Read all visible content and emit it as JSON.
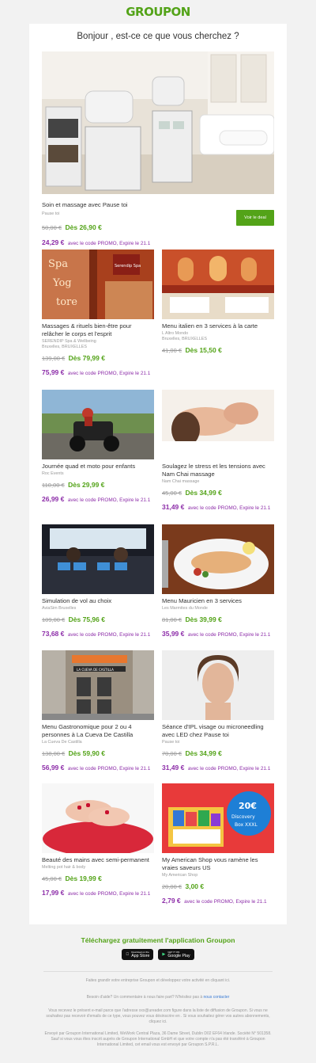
{
  "brand": {
    "logo": "GROUPON",
    "green": "#53a318",
    "purple": "#8c2ca8"
  },
  "greeting": "Bonjour , est-ce ce que vous cherchez ?",
  "hero": {
    "title": "Soin et massage avec Pause toi",
    "merchant": "Pause toi",
    "old_price": "50,00 €",
    "price": "Dès 26,90 €",
    "promo_price": "24,29 €",
    "promo_text": "avec le code PROMO, Expire le 21.1",
    "button": "Voir le deal"
  },
  "deals": [
    {
      "title": "Massages & rituels bien-être pour relâcher le corps et l'esprit",
      "merchant": "SERENDIP Spa & Wellbeing",
      "location": "Bruxelles, BRUXELLES",
      "old_price": "139,00 €",
      "price": "Dès 79,99 €",
      "promo_price": "75,99 €",
      "promo_text": "avec le code PROMO, Expire le 21.1"
    },
    {
      "title": "Menu italien en 3 services à la carte",
      "merchant": "L Altro Mondo",
      "location": "Bruxelles, BRUXELLES",
      "old_price": "41,00 €",
      "price": "Dès 15,50 €",
      "promo_price": "",
      "promo_text": ""
    },
    {
      "title": "Journée quad et moto pour enfants",
      "merchant": "Roc Events",
      "location": "",
      "old_price": "110,00 €",
      "price": "Dès 29,99 €",
      "promo_price": "26,99 €",
      "promo_text": "avec le code PROMO, Expire le 21.1"
    },
    {
      "title": "Soulagez le stress et les tensions avec Nam Chai massage",
      "merchant": "Nam Chai massage",
      "location": "",
      "old_price": "45,00 €",
      "price": "Dès 34,99 €",
      "promo_price": "31,49 €",
      "promo_text": "avec le code PROMO, Expire le 21.1"
    },
    {
      "title": "Simulation de vol au choix",
      "merchant": "AviaSim Bruxelles",
      "location": "",
      "old_price": "109,00 €",
      "price": "Dès 75,96 €",
      "promo_price": "73,68 €",
      "promo_text": "avec le code PROMO, Expire le 21.1"
    },
    {
      "title": "Menu Mauricien en 3 services",
      "merchant": "Les Marmites du Monde",
      "location": "",
      "old_price": "81,00 €",
      "price": "Dès 39,99 €",
      "promo_price": "35,99 €",
      "promo_text": "avec le code PROMO, Expire le 21.1"
    },
    {
      "title": "Menu Gastronomique pour 2 ou 4 personnes à La Cueva De Castilla",
      "merchant": "La Cueva De Castilla",
      "location": "",
      "old_price": "138,00 €",
      "price": "Dès 59,90 €",
      "promo_price": "56,99 €",
      "promo_text": "avec le code PROMO, Expire le 21.1"
    },
    {
      "title": "Séance d'IPL visage ou microneedling avec LED chez Pause toi",
      "merchant": "Pause toi",
      "location": "",
      "old_price": "70,00 €",
      "price": "Dès 34,99 €",
      "promo_price": "31,49 €",
      "promo_text": "avec le code PROMO, Expire le 21.1"
    },
    {
      "title": "Beauté des mains avec semi-permanent",
      "merchant": "Melting pot hair & body",
      "location": "",
      "old_price": "45,00 €",
      "price": "Dès 19,99 €",
      "promo_price": "17,99 €",
      "promo_text": "avec le code PROMO, Expire le 21.1"
    },
    {
      "title": "My American Shop vous ramène les vraies saveurs US",
      "merchant": "My American Shop",
      "location": "",
      "old_price": "20,00 €",
      "price": "3,00 €",
      "promo_price": "2,79 €",
      "promo_text": "avec le code PROMO, Expire le 21.1"
    }
  ],
  "images": {
    "spa_sign": "Spa Yoga tore",
    "serendip": "Serendip Spa",
    "discovery": "20€ Discovery Box XXXL",
    "cueva": "LA CUEVA DE CASTILLA"
  },
  "footer": {
    "app_title": "Téléchargez gratuitement l'application Groupon",
    "appstore_small": "Download on the",
    "appstore": "App Store",
    "googleplay_small": "GET IT ON",
    "googleplay": "Google Play",
    "grow": "Faites grandir votre entreprise Groupon et développez votre activité en cliquant ici.",
    "help": "Besoin d'aide? Un commentaire à nous faire part? N'hésitez pas à",
    "help_link": "nous contacter",
    "legal1": "Vous recevez le présent e-mail parce que l'adresse xxx@ureader.com figure dans la liste de diffusion de Groupon. Si vous ne souhaitez pas recevoir d'emails de ce type, vous pouvez vous désinscrire en . Si vous souhaitez gérer vos autres abonnements, cliquez ici.",
    "legal2": "Envoyé par Groupon International Limited, WeWork Central Plaza, 36 Dame Street, Dublin D02 EF64 Irlande. Société N° 501358. Sauf si vous vous êtes inscrit auprès de Groupon International GmbH et que votre compte n'a pas été transféré à Groupon International Limited, cet email vous est envoyé par Groupon S.P.R.L."
  }
}
